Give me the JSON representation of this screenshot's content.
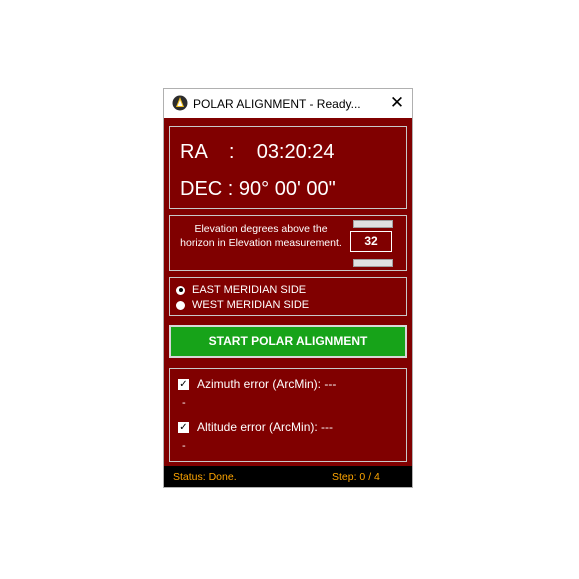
{
  "window": {
    "title": "POLAR ALIGNMENT - Ready...",
    "close_label": "✕"
  },
  "coordinates": {
    "ra_text": "RA    :    03:20:24",
    "dec_text": "DEC : 90° 00' 00\""
  },
  "elevation": {
    "description": "Elevation degrees above the horizon in Elevation measurement.",
    "value": "32"
  },
  "meridian": {
    "options": [
      {
        "label": "EAST MERIDIAN SIDE",
        "selected": true
      },
      {
        "label": "WEST MERIDIAN SIDE",
        "selected": false
      }
    ]
  },
  "start_button": {
    "label": "START POLAR ALIGNMENT"
  },
  "errors": {
    "azimuth_label": "Azimuth  error (ArcMin): ---",
    "azimuth_value": "-",
    "altitude_label": "Altitude error  (ArcMin): ---",
    "altitude_value": "-",
    "azimuth_checked": true,
    "altitude_checked": true
  },
  "statusbar": {
    "status": "Status: Done.",
    "step": "Step: 0 / 4"
  },
  "colors": {
    "background": "#800000",
    "button_green": "#17a319",
    "status_text": "#ffa500"
  },
  "icons": {
    "app": "telescope-app-icon",
    "close": "close-icon",
    "check": "check-icon"
  }
}
